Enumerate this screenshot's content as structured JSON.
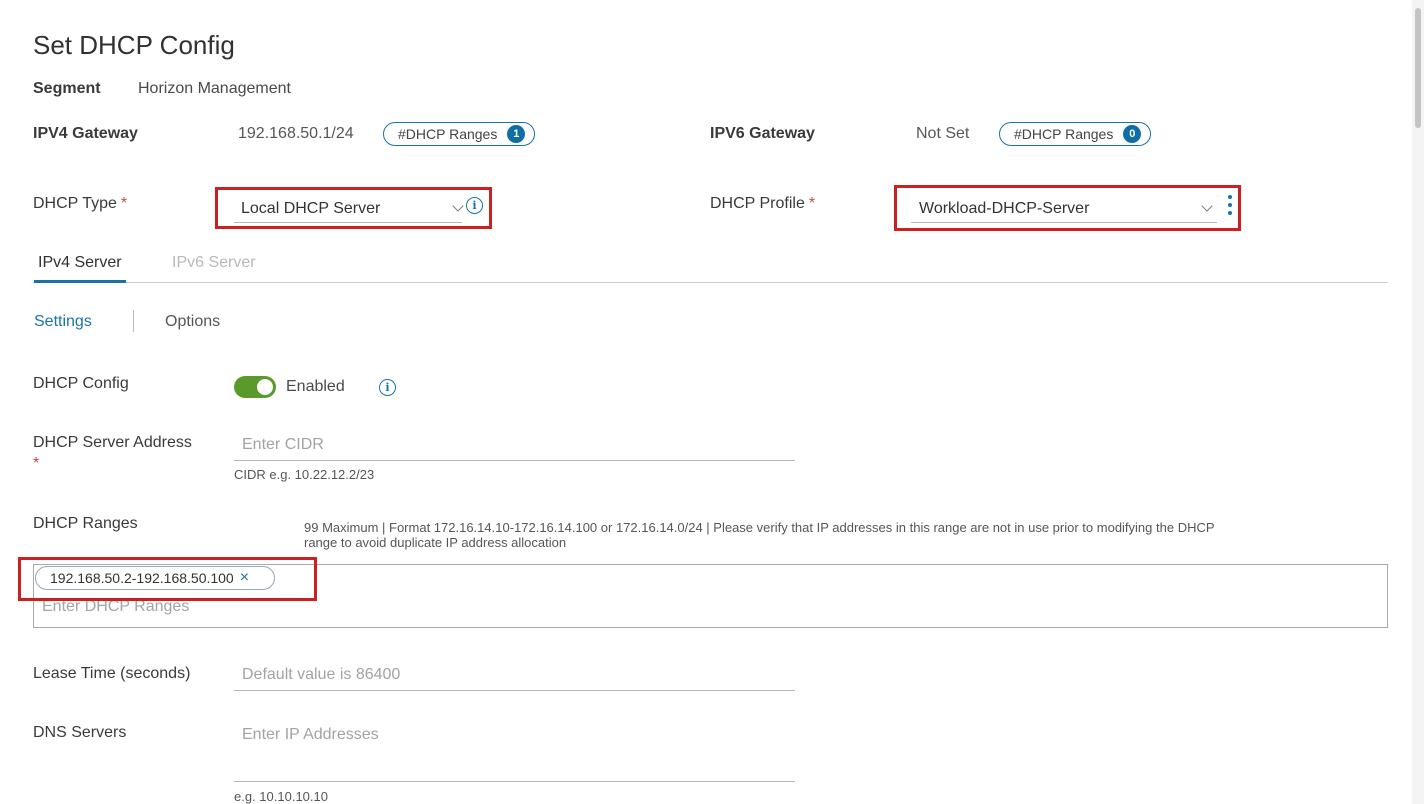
{
  "title": "Set DHCP Config",
  "segment": {
    "label": "Segment",
    "value": "Horizon Management"
  },
  "ipv4_gateway": {
    "label": "IPV4 Gateway",
    "value": "192.168.50.1/24",
    "ranges_label": "#DHCP Ranges",
    "ranges_count": "1"
  },
  "ipv6_gateway": {
    "label": "IPV6 Gateway",
    "value": "Not Set",
    "ranges_label": "#DHCP Ranges",
    "ranges_count": "0"
  },
  "dhcp_type": {
    "label": "DHCP Type",
    "required": "*",
    "value": "Local DHCP Server"
  },
  "dhcp_profile": {
    "label": "DHCP Profile",
    "required": "*",
    "value": "Workload-DHCP-Server"
  },
  "server_tabs": [
    {
      "label": "IPv4 Server"
    },
    {
      "label": "IPv6 Server"
    }
  ],
  "sub_tabs": [
    {
      "label": "Settings"
    },
    {
      "label": "Options"
    }
  ],
  "dhcp_config": {
    "label": "DHCP Config",
    "state": "Enabled"
  },
  "server_address": {
    "label": "DHCP Server Address",
    "required": "*",
    "placeholder": "Enter CIDR",
    "hint": "CIDR e.g. 10.22.12.2/23"
  },
  "dhcp_ranges": {
    "label": "DHCP Ranges",
    "help_line1": "99 Maximum | Format 172.16.14.10-172.16.14.100 or 172.16.14.0/24 | Please verify that IP addresses in this range are not in use prior to modifying the DHCP",
    "help_line2": "range to avoid duplicate IP address allocation",
    "chip": "192.168.50.2-192.168.50.100",
    "chip_remove": "×",
    "placeholder": "Enter DHCP Ranges"
  },
  "lease_time": {
    "label": "Lease Time (seconds)",
    "placeholder": "Default value is 86400"
  },
  "dns_servers": {
    "label": "DNS Servers",
    "placeholder": "Enter IP Addresses",
    "hint": "e.g. 10.10.10.10"
  },
  "colors": {
    "accent": "#1a73a8",
    "toggle_on": "#5a9a2a",
    "highlight": "#cc1f1f",
    "required": "#c9493a"
  },
  "icons": {
    "info": "info-icon",
    "chevron": "chevron-down-icon",
    "kebab": "more-vertical-icon",
    "close": "close-icon"
  }
}
